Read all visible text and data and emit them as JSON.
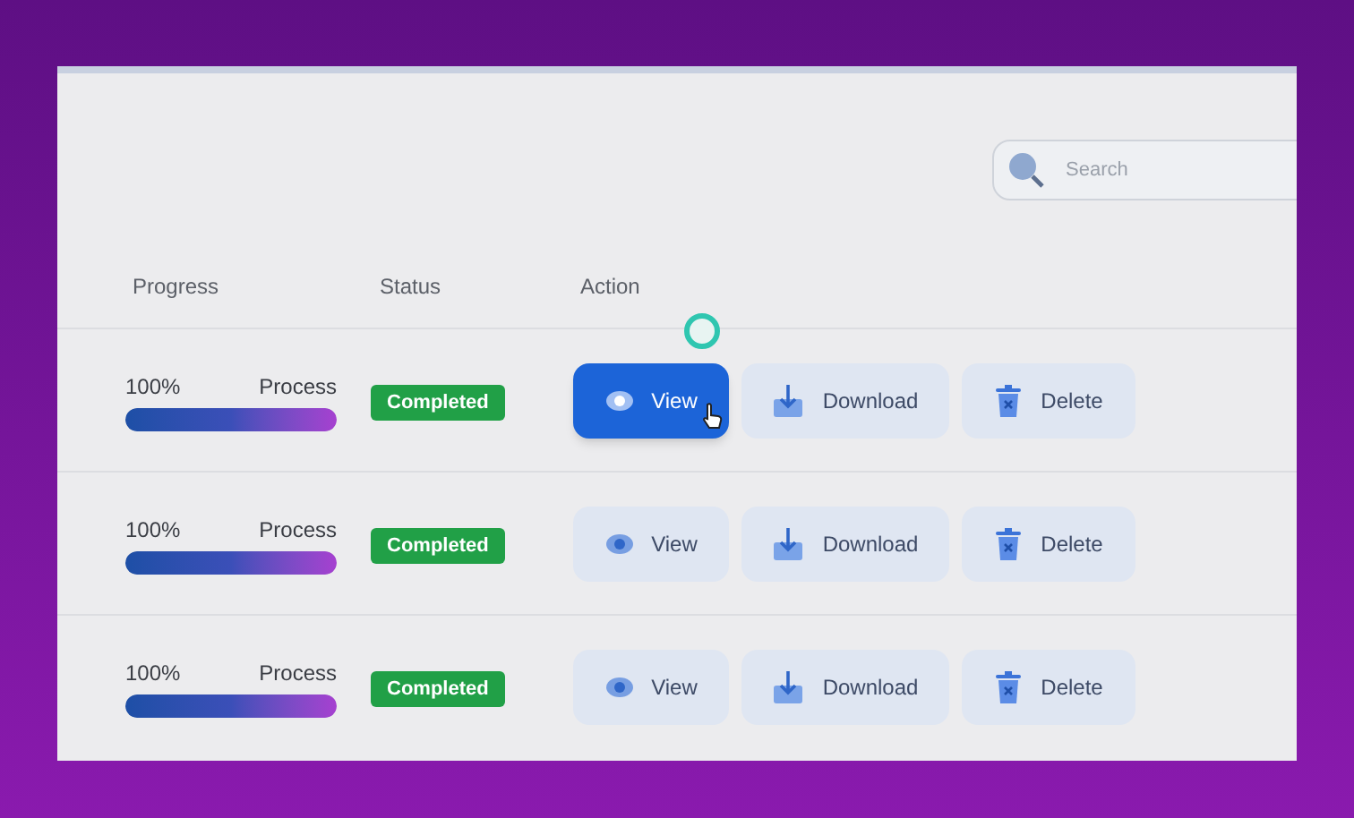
{
  "search": {
    "placeholder": "Search"
  },
  "table": {
    "columns": [
      "Progress",
      "Status",
      "Action"
    ],
    "rows": [
      {
        "percent": "100%",
        "label": "Process",
        "level": 1,
        "status": "Completed",
        "actions": [
          {
            "kind": "view",
            "label": "View",
            "selected": true
          },
          {
            "kind": "download",
            "label": "Download",
            "selected": false
          },
          {
            "kind": "delete",
            "label": "Delete",
            "selected": false
          }
        ]
      },
      {
        "percent": "100%",
        "label": "Process",
        "level": 1,
        "status": "Completed",
        "actions": [
          {
            "kind": "view",
            "label": "View",
            "selected": false
          },
          {
            "kind": "download",
            "label": "Download",
            "selected": false
          },
          {
            "kind": "delete",
            "label": "Delete",
            "selected": false
          }
        ]
      },
      {
        "percent": "100%",
        "label": "Process",
        "level": 1,
        "status": "Completed",
        "actions": [
          {
            "kind": "view",
            "label": "View",
            "selected": false
          },
          {
            "kind": "download",
            "label": "Download",
            "selected": false
          },
          {
            "kind": "delete",
            "label": "Delete",
            "selected": false
          }
        ]
      }
    ]
  }
}
